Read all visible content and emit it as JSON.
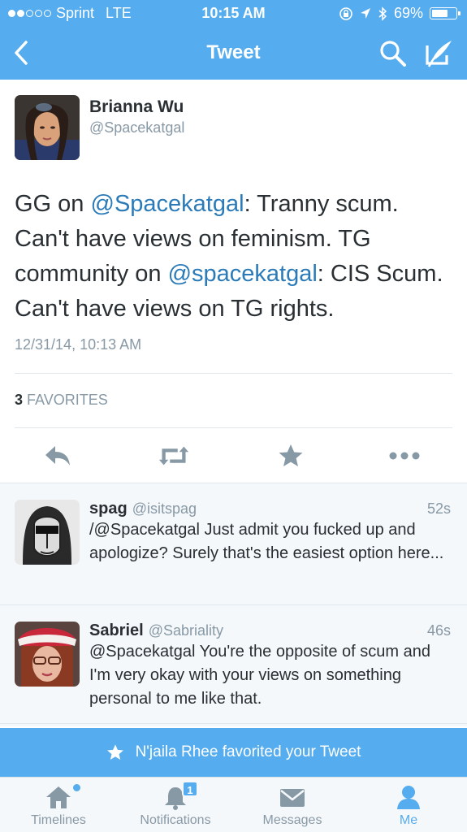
{
  "status_bar": {
    "carrier": "Sprint",
    "network": "LTE",
    "time": "10:15 AM",
    "battery": "69%",
    "battery_level": 0.69,
    "signal_bars_filled": 2,
    "signal_bars_total": 5
  },
  "nav": {
    "title": "Tweet",
    "back_icon": "chevron-left-icon",
    "search_icon": "search-icon",
    "compose_icon": "compose-icon"
  },
  "tweet": {
    "author_name": "Brianna Wu",
    "author_handle": "@Spacekatgal",
    "text_part1": "GG on ",
    "mention1": "@Spacekatgal",
    "text_part2": ": Tranny scum. Can't have views on feminism. TG community on ",
    "mention2": "@spacekatgal",
    "text_part3": ": CIS Scum. Can't have views on TG rights.",
    "date": "12/31/14, 10:13 AM",
    "favorites_count": "3",
    "favorites_label": "FAVORITES"
  },
  "actions": [
    "reply-icon",
    "retweet-icon",
    "favorite-icon",
    "more-icon"
  ],
  "replies": [
    {
      "name": "spag",
      "handle": "@isitspag",
      "time": "52s",
      "text": "/@Spacekatgal Just admit you fucked up and apologize? Surely that's the easiest option here..."
    },
    {
      "name": "Sabriel",
      "handle": "@Sabriality",
      "time": "46s",
      "text": "@Spacekatgal You're the opposite of scum and I'm very okay with your views on something personal to me like that."
    }
  ],
  "banner": {
    "text": "N'jaila Rhee favorited your Tweet",
    "icon": "star-icon"
  },
  "tabbar": {
    "tabs": [
      {
        "label": "Timelines",
        "icon": "home-icon"
      },
      {
        "label": "Notifications",
        "icon": "bell-icon",
        "badge": "1"
      },
      {
        "label": "Messages",
        "icon": "envelope-icon"
      },
      {
        "label": "Me",
        "icon": "person-icon"
      }
    ],
    "active": "Me"
  },
  "colors": {
    "brand_blue": "#55acee",
    "link_blue": "#2b7bb9",
    "text": "#292f33",
    "muted": "#8899a6",
    "background_alt": "#f5f8fa"
  }
}
